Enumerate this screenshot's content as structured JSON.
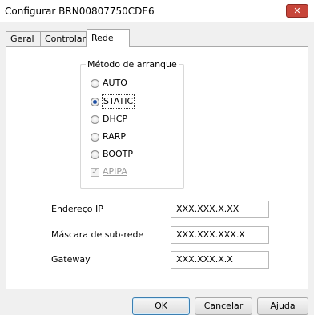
{
  "window": {
    "title": "Configurar BRN00807750CDE6",
    "close_glyph": "✕"
  },
  "tabs": [
    {
      "label": "Geral",
      "selected": false
    },
    {
      "label": "Controlar",
      "selected": false
    },
    {
      "label": "Rede",
      "selected": true
    }
  ],
  "boot_method": {
    "group_label": "Método de arranque",
    "options": [
      {
        "label": "AUTO",
        "checked": false
      },
      {
        "label": "STATIC",
        "checked": true
      },
      {
        "label": "DHCP",
        "checked": false
      },
      {
        "label": "RARP",
        "checked": false
      },
      {
        "label": "BOOTP",
        "checked": false
      }
    ],
    "apipa": {
      "label": "APIPA",
      "checked": true,
      "enabled": false
    }
  },
  "fields": {
    "ip": {
      "label": "Endereço IP",
      "value": "XXX.XXX.X.XX"
    },
    "subnet": {
      "label": "Máscara de sub-rede",
      "value": "XXX.XXX.XXX.X"
    },
    "gateway": {
      "label": "Gateway",
      "value": "XXX.XXX.X.X"
    }
  },
  "buttons": {
    "ok": "OK",
    "cancel": "Cancelar",
    "help": "Ajuda"
  },
  "colors": {
    "close_button": "#c7453a",
    "selected_radio": "#1f4fa3",
    "default_button_border": "#3c7fb1"
  }
}
